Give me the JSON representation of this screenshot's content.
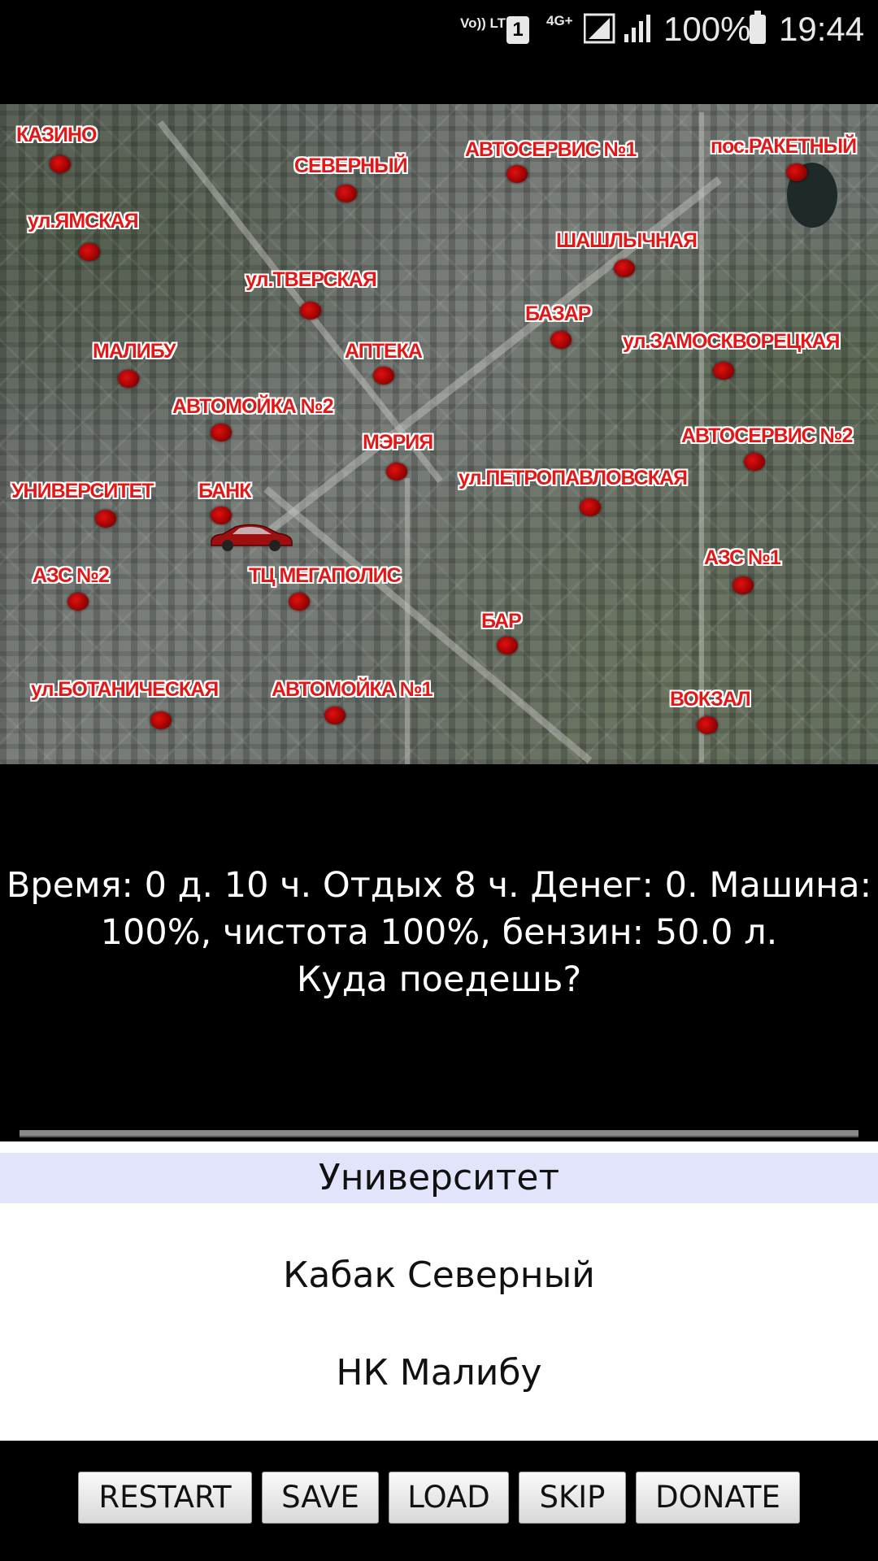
{
  "status_bar": {
    "volte": "Vo)) LTE",
    "sim": "1",
    "network": "4G+",
    "battery_percent": "100%",
    "time": "19:44",
    "icons": [
      "volte-icon",
      "sim-icon",
      "signal-icon",
      "signal-icon",
      "battery-icon"
    ]
  },
  "map": {
    "locations": [
      "КАЗИНО",
      "СЕВЕРНЫЙ",
      "АВТОСЕРВИС №1",
      "пос.РАКЕТНЫЙ",
      "ул.ЯМСКАЯ",
      "ШАШЛЫЧНАЯ",
      "ул.ТВЕРСКАЯ",
      "БАЗАР",
      "МАЛИБУ",
      "АПТЕКА",
      "ул.ЗАМОСКВОРЕЦКАЯ",
      "АВТОМОЙКА №2",
      "АВТОСЕРВИС №2",
      "МЭРИЯ",
      "УНИВЕРСИТЕТ",
      "БАНК",
      "ул.ПЕТРОПАВЛОВСКАЯ",
      "АЗС №1",
      "АЗС №2",
      "ТЦ МЕГАПОЛИС",
      "БАР",
      "ул.БОТАНИЧЕСКАЯ",
      "АВТОМОЙКА №1",
      "ВОКЗАЛ"
    ]
  },
  "info": {
    "line1": "Время: 0 д. 10 ч. Отдых 8 ч. Денег: 0. Машина:",
    "line2": "100%, чистота 100%, бензин: 50.0 л.",
    "line3": "Куда поедешь?"
  },
  "destinations": [
    "Университет",
    "Кабак Северный",
    "НК Малибу"
  ],
  "buttons": [
    "RESTART",
    "SAVE",
    "LOAD",
    "SKIP",
    "DONATE"
  ],
  "colors": {
    "marker": "#c00000",
    "label": "#e01818",
    "selected_item_bg": "#e2e4fb"
  }
}
